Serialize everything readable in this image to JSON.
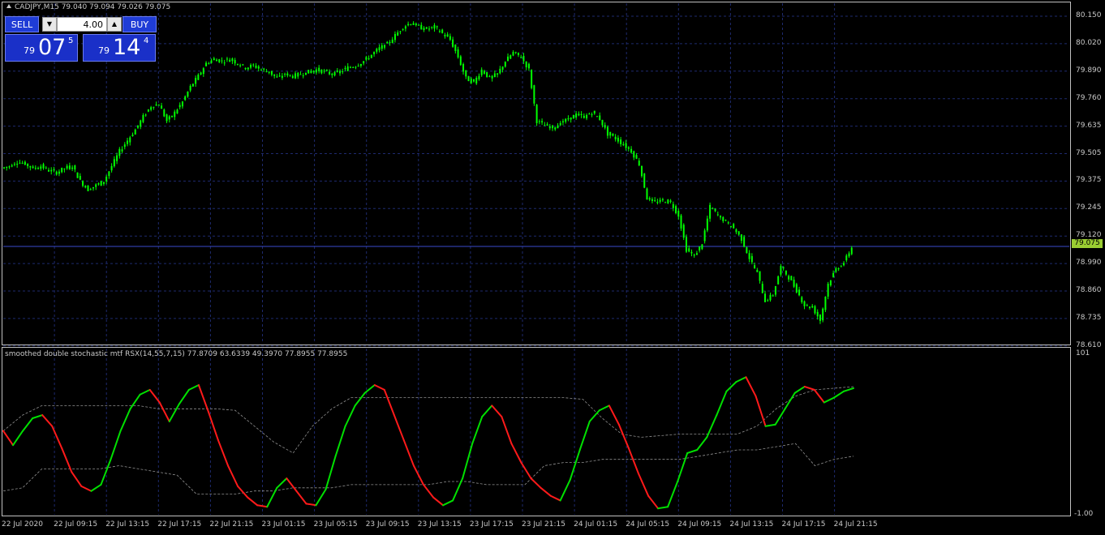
{
  "chart": {
    "title": "CADJPY,M15  79.040 79.094 79.026 79.075",
    "current_price": "79.075",
    "price_labels": [
      "80.150",
      "80.020",
      "79.890",
      "79.760",
      "79.635",
      "79.505",
      "79.375",
      "79.245",
      "79.120",
      "78.990",
      "78.860",
      "78.735",
      "78.610"
    ],
    "time_labels": [
      "22 Jul 2020",
      "22 Jul 09:15",
      "22 Jul 13:15",
      "22 Jul 17:15",
      "22 Jul 21:15",
      "23 Jul 01:15",
      "23 Jul 05:15",
      "23 Jul 09:15",
      "23 Jul 13:15",
      "23 Jul 17:15",
      "23 Jul 21:15",
      "24 Jul 01:15",
      "24 Jul 05:15",
      "24 Jul 09:15",
      "24 Jul 13:15",
      "24 Jul 17:15",
      "24 Jul 21:15"
    ]
  },
  "trade_panel": {
    "sell_label": "SELL",
    "buy_label": "BUY",
    "lot_value": "4.00",
    "sell_prefix": "79",
    "sell_big": "07",
    "sell_sup": "5",
    "buy_prefix": "79",
    "buy_big": "14",
    "buy_sup": "4"
  },
  "indicator": {
    "title": "smoothed double stochastic mtf RSX(14,55,7,15) 77.8709 63.6339 49.3970 77.8955 77.8955",
    "top_label": "101",
    "bottom_label": "-1.00"
  },
  "colors": {
    "background": "#000000",
    "candle": "#00ff00",
    "grid": "#1e2a6e",
    "up_line": "#00e000",
    "down_line": "#ff1a1a",
    "price_tag": "#9acd32",
    "button": "#1f3cd6"
  },
  "chart_data": {
    "type": "line",
    "price_series": [
      79.44,
      79.45,
      79.47,
      79.46,
      79.44,
      79.45,
      79.43,
      79.42,
      79.44,
      79.45,
      79.38,
      79.34,
      79.36,
      79.38,
      79.45,
      79.52,
      79.57,
      79.62,
      79.68,
      79.73,
      79.74,
      79.66,
      79.7,
      79.75,
      79.82,
      79.87,
      79.93,
      79.95,
      79.94,
      79.95,
      79.93,
      79.91,
      79.92,
      79.9,
      79.89,
      79.86,
      79.88,
      79.87,
      79.88,
      79.89,
      79.9,
      79.89,
      79.88,
      79.89,
      79.91,
      79.92,
      79.94,
      79.97,
      80.0,
      80.02,
      80.06,
      80.1,
      80.12,
      80.1,
      80.09,
      80.1,
      80.07,
      80.04,
      79.96,
      79.86,
      79.84,
      79.9,
      79.86,
      79.88,
      79.94,
      79.98,
      79.96,
      79.9,
      79.66,
      79.64,
      79.63,
      79.65,
      79.67,
      79.69,
      79.68,
      79.7,
      79.67,
      79.6,
      79.58,
      79.55,
      79.52,
      79.46,
      79.3,
      79.28,
      79.29,
      79.28,
      79.22,
      79.06,
      79.03,
      79.09,
      79.26,
      79.22,
      79.19,
      79.16,
      79.11,
      79.02,
      78.95,
      78.82,
      78.85,
      78.98,
      78.93,
      78.87,
      78.8,
      78.79,
      78.73,
      78.9,
      78.97,
      79.0,
      79.07
    ],
    "rsx_series": [
      {
        "name": "RSX",
        "values": [
          52,
          43,
          52,
          60,
          62,
          55,
          41,
          26,
          17,
          14,
          18,
          34,
          52,
          66,
          75,
          78,
          70,
          58,
          69,
          78,
          81,
          64,
          46,
          30,
          17,
          10,
          5,
          4,
          16,
          22,
          14,
          6,
          5,
          15,
          36,
          55,
          68,
          76,
          81,
          78,
          62,
          46,
          30,
          18,
          10,
          5,
          8,
          22,
          44,
          61,
          68,
          61,
          44,
          32,
          22,
          16,
          11,
          8,
          21,
          40,
          58,
          65,
          68,
          56,
          41,
          25,
          11,
          3,
          4,
          20,
          38,
          40,
          48,
          62,
          77,
          83,
          86,
          74,
          55,
          56,
          66,
          76,
          80,
          78,
          70,
          73,
          77,
          79
        ]
      }
    ],
    "upper_band_values": [
      52,
      62,
      68,
      68,
      68,
      68,
      68,
      68,
      66,
      66,
      66,
      66,
      65,
      55,
      45,
      38,
      55,
      66,
      73,
      73,
      73,
      73,
      73,
      73,
      73,
      73,
      73,
      73,
      73,
      73,
      72,
      60,
      50,
      48,
      49,
      50,
      50,
      50,
      50,
      55,
      66,
      74,
      78,
      79,
      80
    ],
    "lower_band_values": [
      14,
      16,
      28,
      28,
      28,
      28,
      30,
      28,
      26,
      24,
      12,
      12,
      12,
      14,
      14,
      16,
      16,
      16,
      18,
      18,
      18,
      18,
      18,
      20,
      20,
      18,
      18,
      18,
      30,
      32,
      32,
      34,
      34,
      34,
      34,
      34,
      36,
      38,
      40,
      40,
      42,
      44,
      30,
      34,
      36
    ]
  }
}
